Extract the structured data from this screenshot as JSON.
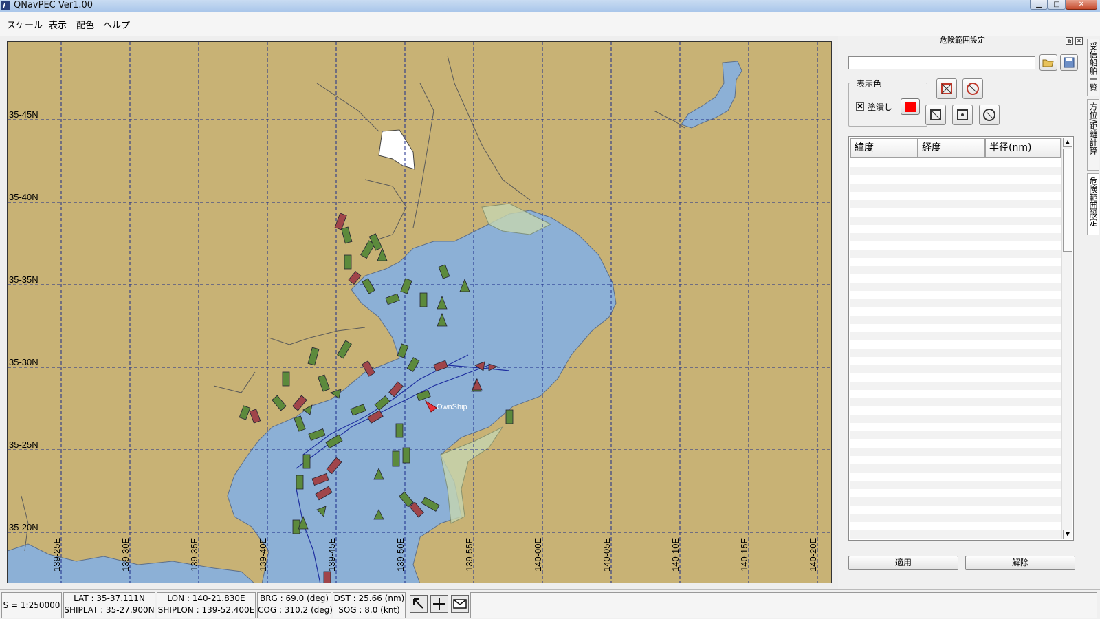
{
  "window": {
    "title": "QNavPEC Ver1.00"
  },
  "menu": {
    "items": [
      "スケール",
      "表示",
      "配色",
      "ヘルプ"
    ]
  },
  "map": {
    "lat_labels": [
      "35-45N",
      "35-40N",
      "35-35N",
      "35-30N",
      "35-25N",
      "35-20N"
    ],
    "lon_labels": [
      "139-25E",
      "139-30E",
      "139-35E",
      "139-40E",
      "139-45E",
      "139-50E",
      "139-55E",
      "140-00E",
      "140-05E",
      "140-10E",
      "140-15E",
      "140-20E"
    ],
    "own_ship_label": "OwnShip",
    "colors": {
      "land": "#c8b275",
      "water": "#8cb0d6",
      "grid": "#1a2a8a",
      "ship_green": "#5c8a3c",
      "ship_red": "#a0454a",
      "own_ship": "#e8323c"
    }
  },
  "panel": {
    "title": "危険範囲設定",
    "path_value": "",
    "display_color_group": "表示色",
    "fill_label": "塗潰し",
    "fill_checked_mark": "✖",
    "fill_color": "#ff0000",
    "table_headers": [
      "緯度",
      "経度",
      "半径(nm)"
    ],
    "apply_label": "適用",
    "release_label": "解除"
  },
  "side_tabs": [
    "受信船舶一覧",
    "方位/距離計算",
    "危険範囲設定"
  ],
  "status": {
    "scale": "S = 1:250000",
    "lat": "LAT : 35-37.111N",
    "shiplat": "SHIPLAT : 35-27.900N",
    "lon": "LON : 140-21.830E",
    "shiplon": "SHIPLON : 139-52.400E",
    "brg": "BRG : 69.0 (deg)",
    "cog": "COG : 310.2 (deg)",
    "dst": "DST : 25.66 (nm)",
    "sog": "SOG : 8.0 (knt)"
  }
}
